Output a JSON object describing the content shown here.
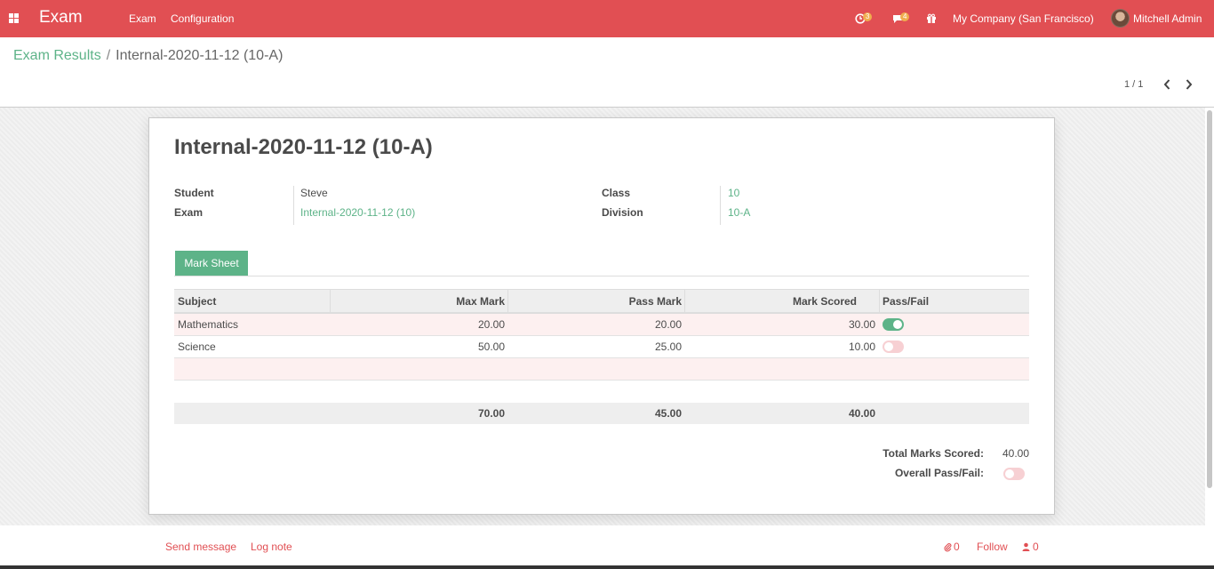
{
  "navbar": {
    "brand": "Exam",
    "menu": [
      "Exam",
      "Configuration"
    ],
    "activity_count": "3",
    "message_count": "4",
    "company": "My Company (San Francisco)",
    "user": "Mitchell Admin",
    "icons": [
      "apps-icon",
      "activity-icon",
      "chat-icon",
      "gift-icon"
    ]
  },
  "breadcrumb": {
    "parent": "Exam Results",
    "separator": "/",
    "current": "Internal-2020-11-12 (10-A)"
  },
  "pager": {
    "value": "1 / 1"
  },
  "record": {
    "title": "Internal-2020-11-12 (10-A)",
    "fields": {
      "student_label": "Student",
      "student_value": "Steve",
      "exam_label": "Exam",
      "exam_value": "Internal-2020-11-12 (10)",
      "class_label": "Class",
      "class_value": "10",
      "division_label": "Division",
      "division_value": "10-A"
    },
    "tab": "Mark Sheet",
    "table": {
      "headers": [
        "Subject",
        "Max Mark",
        "Pass Mark",
        "Mark Scored",
        "Pass/Fail"
      ],
      "rows": [
        {
          "subject": "Mathematics",
          "max": "20.00",
          "pass": "20.00",
          "scored": "30.00",
          "pass_fail": true
        },
        {
          "subject": "Science",
          "max": "50.00",
          "pass": "25.00",
          "scored": "10.00",
          "pass_fail": false
        }
      ],
      "totals": {
        "max": "70.00",
        "pass": "45.00",
        "scored": "40.00"
      }
    },
    "summary": {
      "total_label": "Total Marks Scored:",
      "total_value": "40.00",
      "overall_label": "Overall Pass/Fail:",
      "overall_value": false
    }
  },
  "chatter": {
    "send_message": "Send message",
    "log_note": "Log note",
    "attachments": "0",
    "follow": "Follow",
    "followers": "0"
  },
  "colors": {
    "navbar": "#e14f53",
    "accent": "#5db388"
  }
}
